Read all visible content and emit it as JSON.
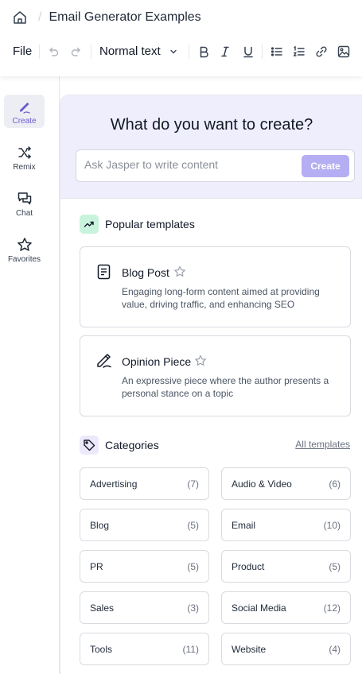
{
  "header": {
    "doc_title": "Email Generator Examples"
  },
  "toolbar": {
    "file_label": "File",
    "text_style": "Normal text"
  },
  "sidebar": {
    "items": [
      {
        "label": "Create",
        "icon": "pen-icon"
      },
      {
        "label": "Remix",
        "icon": "shuffle-icon"
      },
      {
        "label": "Chat",
        "icon": "chat-bubbles-icon"
      },
      {
        "label": "Favorites",
        "icon": "star-icon"
      }
    ]
  },
  "hero": {
    "title": "What do you want to create?",
    "placeholder": "Ask Jasper to write content",
    "create_label": "Create"
  },
  "popular": {
    "title": "Popular templates",
    "templates": [
      {
        "name": "Blog Post",
        "description": "Engaging long-form content aimed at providing value, driving traffic, and enhancing SEO"
      },
      {
        "name": "Opinion Piece",
        "description": "An expressive piece where the author presents a personal stance on a topic"
      }
    ]
  },
  "categories": {
    "title": "Categories",
    "all_link": "All templates",
    "items": [
      {
        "name": "Advertising",
        "count": "(7)"
      },
      {
        "name": "Audio & Video",
        "count": "(6)"
      },
      {
        "name": "Blog",
        "count": "(5)"
      },
      {
        "name": "Email",
        "count": "(10)"
      },
      {
        "name": "PR",
        "count": "(5)"
      },
      {
        "name": "Product",
        "count": "(5)"
      },
      {
        "name": "Sales",
        "count": "(3)"
      },
      {
        "name": "Social Media",
        "count": "(12)"
      },
      {
        "name": "Tools",
        "count": "(11)"
      },
      {
        "name": "Website",
        "count": "(4)"
      }
    ]
  },
  "colors": {
    "accent": "#6d5bd0",
    "create_button": "#b6aef2",
    "hero_bg": "#efeefc",
    "popular_icon_bg": "#c9f3dc"
  }
}
